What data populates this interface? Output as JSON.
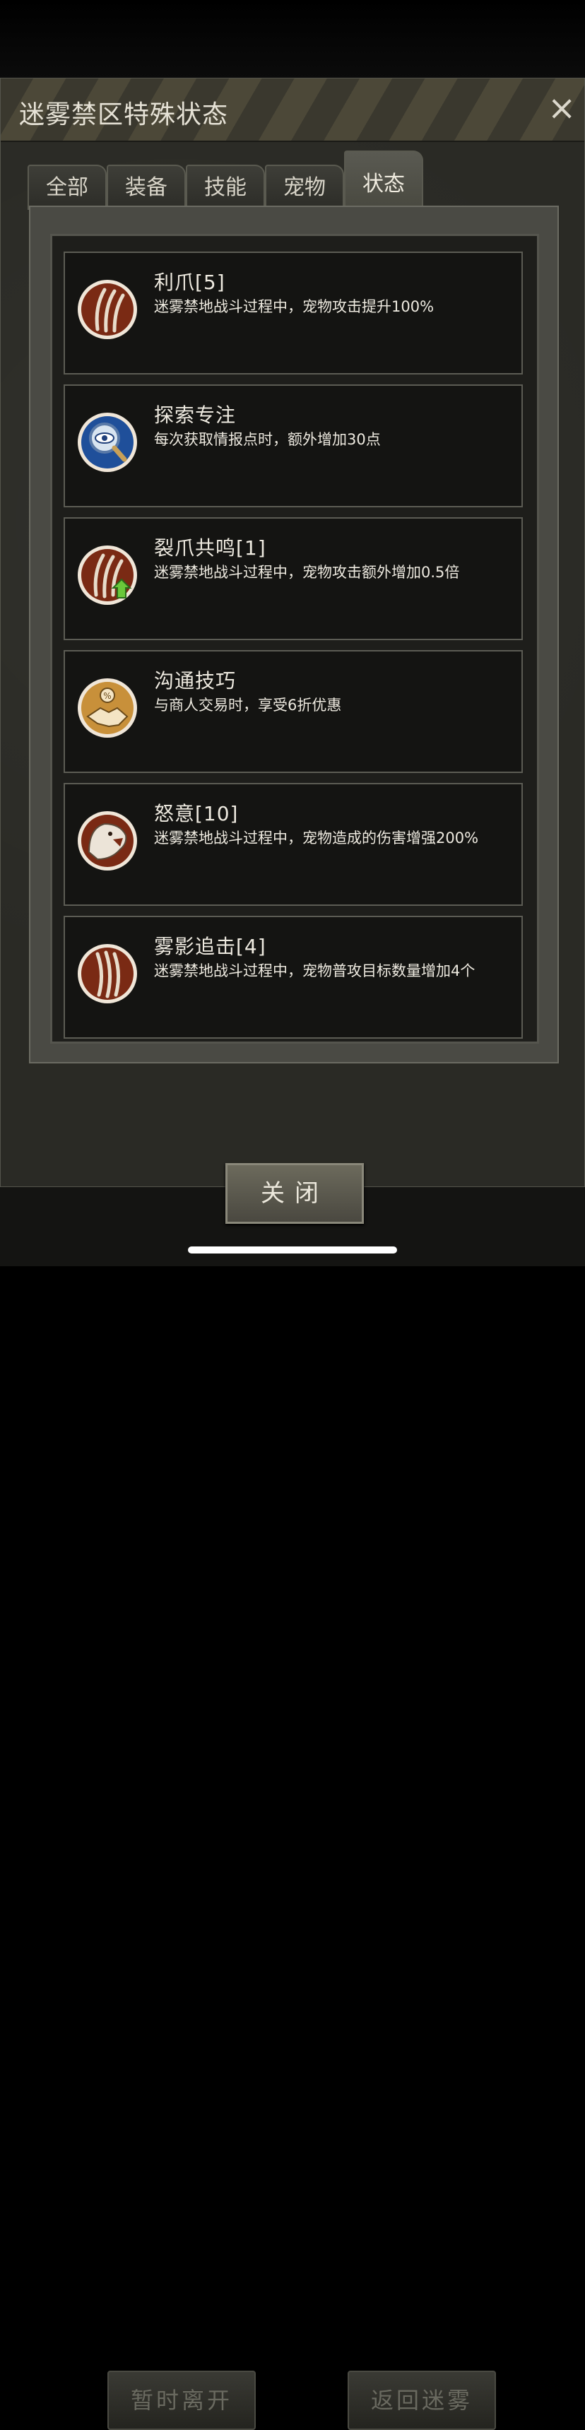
{
  "window": {
    "title": "迷雾禁区特殊状态",
    "close_icon": "×"
  },
  "tabs": [
    {
      "label": "全部",
      "active": false
    },
    {
      "label": "装备",
      "active": false
    },
    {
      "label": "技能",
      "active": false
    },
    {
      "label": "宠物",
      "active": false
    },
    {
      "label": "状态",
      "active": true
    }
  ],
  "status_items": [
    {
      "name": "利爪[5]",
      "desc": "迷雾禁地战斗过程中，宠物攻击提升100%",
      "icon": "claw-icon"
    },
    {
      "name": "探索专注",
      "desc": "每次获取情报点时，额外增加30点",
      "icon": "magnifier-eye-icon"
    },
    {
      "name": "裂爪共鸣[1]",
      "desc": "迷雾禁地战斗过程中，宠物攻击额外增加0.5倍",
      "icon": "claw-upgrade-icon"
    },
    {
      "name": "沟通技巧",
      "desc": "与商人交易时，享受6折优惠",
      "icon": "handshake-discount-icon"
    },
    {
      "name": "怒意[10]",
      "desc": "迷雾禁地战斗过程中，宠物造成的伤害增强200%",
      "icon": "angry-beast-icon"
    },
    {
      "name": "雾影追击[4]",
      "desc": "迷雾禁地战斗过程中，宠物普攻目标数量增加4个",
      "icon": "claw-marks-icon"
    }
  ],
  "close_button": "关闭",
  "background_buttons": [
    "暂时离开",
    "返回迷雾"
  ]
}
